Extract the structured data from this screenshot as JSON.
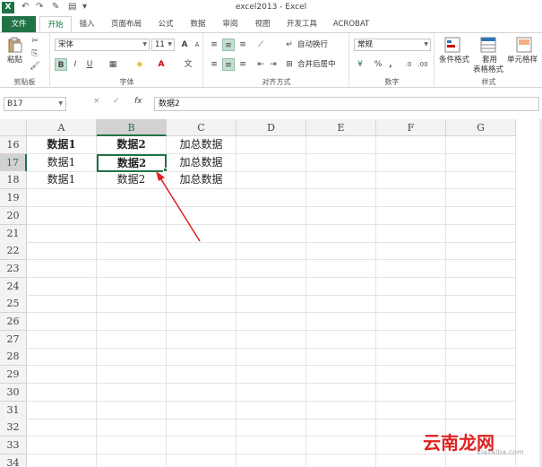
{
  "app": {
    "window_title": "excel2013 - Excel",
    "logo": "X"
  },
  "tabs": [
    {
      "label": "文件"
    },
    {
      "label": "开始"
    },
    {
      "label": "插入"
    },
    {
      "label": "页面布局"
    },
    {
      "label": "公式"
    },
    {
      "label": "数据"
    },
    {
      "label": "审阅"
    },
    {
      "label": "视图"
    },
    {
      "label": "开发工具"
    },
    {
      "label": "ACROBAT"
    }
  ],
  "ribbon": {
    "clipboard": {
      "label": "剪贴板",
      "paste": "粘贴"
    },
    "font": {
      "label": "字体",
      "name": "宋体",
      "size": "11",
      "grow": "A",
      "shrink": "A",
      "bold": "B",
      "italic": "I",
      "underline": "U"
    },
    "alignment": {
      "label": "对齐方式",
      "wrap": "自动换行",
      "merge": "合并后居中"
    },
    "number": {
      "label": "数字",
      "format": "常规",
      "percent": "%",
      "comma": ","
    },
    "styles": {
      "label": "样式",
      "conditional": "条件格式",
      "table1": "套用",
      "table2": "表格格式",
      "cell": "单元格样"
    }
  },
  "formula_bar": {
    "name_box": "B17",
    "cancel": "×",
    "enter": "✓",
    "fx": "fx",
    "content": "数据2"
  },
  "columns": [
    "A",
    "B",
    "C",
    "D",
    "E",
    "F",
    "G"
  ],
  "selected_column": "B",
  "selected_row": "17",
  "rows": [
    {
      "num": "16",
      "cells": [
        "数据1",
        "数据2",
        "加总数据"
      ]
    },
    {
      "num": "17",
      "cells": [
        "数据1",
        "数据2",
        "加总数据"
      ]
    },
    {
      "num": "18",
      "cells": [
        "数据1",
        "数据2",
        "加总数据"
      ]
    },
    {
      "num": "19",
      "cells": []
    },
    {
      "num": "20",
      "cells": []
    },
    {
      "num": "21",
      "cells": []
    },
    {
      "num": "22",
      "cells": []
    },
    {
      "num": "23",
      "cells": []
    },
    {
      "num": "24",
      "cells": []
    },
    {
      "num": "25",
      "cells": []
    },
    {
      "num": "26",
      "cells": []
    },
    {
      "num": "27",
      "cells": []
    },
    {
      "num": "28",
      "cells": []
    },
    {
      "num": "29",
      "cells": []
    },
    {
      "num": "30",
      "cells": []
    },
    {
      "num": "31",
      "cells": []
    },
    {
      "num": "32",
      "cells": []
    },
    {
      "num": "33",
      "cells": []
    },
    {
      "num": "34",
      "cells": []
    }
  ],
  "watermark": {
    "text": "云南龙网",
    "url": "xiazaiba.com"
  },
  "colors": {
    "accent": "#217346",
    "annotation": "#e02020"
  }
}
